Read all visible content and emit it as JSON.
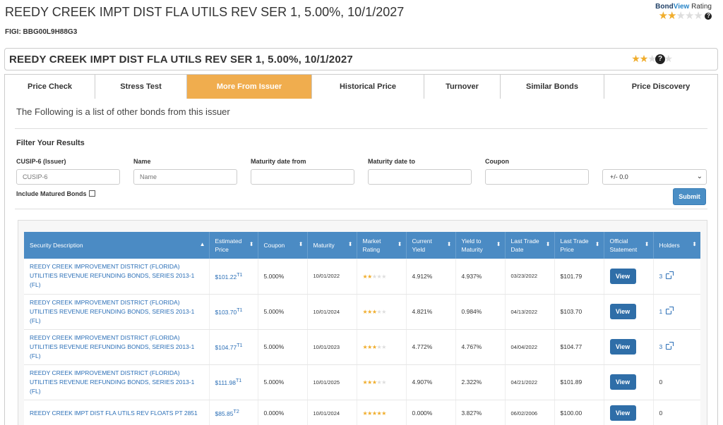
{
  "page": {
    "title": "REEDY CREEK IMPT DIST FLA UTILS REV SER 1, 5.00%, 10/1/2027",
    "figi": "FIGI: BBG00L9H88G3"
  },
  "bondview": {
    "label_bond": "Bond",
    "label_view": "View",
    "label_rating": " Rating",
    "stars_on": "★★",
    "stars_off": "★★★",
    "help": "?"
  },
  "header": {
    "name": "REEDY CREEK IMPT DIST FLA UTILS REV SER 1, 5.00%, 10/1/2027",
    "stars_on": "★★",
    "stars_off": "★★★",
    "help": "?"
  },
  "tabs": [
    {
      "label": "Price Check"
    },
    {
      "label": "Stress Test"
    },
    {
      "label": "More From Issuer"
    },
    {
      "label": "Historical Price"
    },
    {
      "label": "Turnover"
    },
    {
      "label": "Similar Bonds"
    },
    {
      "label": "Price Discovery"
    }
  ],
  "content": {
    "intro": "The Following is a list of other bonds from this issuer",
    "filter_title": "Filter Your Results",
    "filters": {
      "cusip_label": "CUSIP-6 (Issuer)",
      "cusip_placeholder": "CUSIP-6",
      "name_label": "Name",
      "name_placeholder": "Name",
      "mat_from_label": "Maturity date from",
      "mat_to_label": "Maturity date to",
      "coupon_label": "Coupon",
      "coupon_select": "+/- 0.0",
      "matured_label": "Include Matured Bonds",
      "submit": "Submit"
    }
  },
  "table": {
    "headers": [
      {
        "l1": "Security Description",
        "l2": ""
      },
      {
        "l1": "Estimated",
        "l2": "Price"
      },
      {
        "l1": "Coupon",
        "l2": ""
      },
      {
        "l1": "Maturity",
        "l2": ""
      },
      {
        "l1": "Market",
        "l2": "Rating"
      },
      {
        "l1": "Current",
        "l2": "Yield"
      },
      {
        "l1": "Yield to",
        "l2": "Maturity"
      },
      {
        "l1": "Last Trade",
        "l2": "Date"
      },
      {
        "l1": "Last Trade",
        "l2": "Price"
      },
      {
        "l1": "Official",
        "l2": "Statement"
      },
      {
        "l1": "Holders",
        "l2": ""
      }
    ],
    "rows": [
      {
        "desc": "REEDY CREEK IMPROVEMENT DISTRICT (FLORIDA) UTILITIES REVENUE REFUNDING BONDS, SERIES 2013-1 (FL)",
        "price": "$101.22",
        "tag": "T1",
        "coupon": "5.000%",
        "maturity": "10/01/2022",
        "stars_on": "★★",
        "stars_off": "★★★",
        "cy": "4.912%",
        "ytm": "4.937%",
        "ltd": "03/23/2022",
        "ltp": "$101.79",
        "view": "View",
        "holders": "3",
        "link": true
      },
      {
        "desc": "REEDY CREEK IMPROVEMENT DISTRICT (FLORIDA) UTILITIES REVENUE REFUNDING BONDS, SERIES 2013-1 (FL)",
        "price": "$103.70",
        "tag": "T1",
        "coupon": "5.000%",
        "maturity": "10/01/2024",
        "stars_on": "★★★",
        "stars_off": "★★",
        "cy": "4.821%",
        "ytm": "0.984%",
        "ltd": "04/13/2022",
        "ltp": "$103.70",
        "view": "View",
        "holders": "1",
        "link": true
      },
      {
        "desc": "REEDY CREEK IMPROVEMENT DISTRICT (FLORIDA) UTILITIES REVENUE REFUNDING BONDS, SERIES 2013-1 (FL)",
        "price": "$104.77",
        "tag": "T1",
        "coupon": "5.000%",
        "maturity": "10/01/2023",
        "stars_on": "★★★",
        "stars_off": "★★",
        "cy": "4.772%",
        "ytm": "4.767%",
        "ltd": "04/04/2022",
        "ltp": "$104.77",
        "view": "View",
        "holders": "3",
        "link": true
      },
      {
        "desc": "REEDY CREEK IMPROVEMENT DISTRICT (FLORIDA) UTILITIES REVENUE REFUNDING BONDS, SERIES 2013-1 (FL)",
        "price": "$111.98",
        "tag": "T1",
        "coupon": "5.000%",
        "maturity": "10/01/2025",
        "stars_on": "★★★",
        "stars_off": "★★",
        "cy": "4.907%",
        "ytm": "2.322%",
        "ltd": "04/21/2022",
        "ltp": "$101.89",
        "view": "View",
        "holders": "0",
        "link": false
      },
      {
        "desc": "REEDY CREEK IMPT DIST FLA UTILS REV FLOATS PT 2851",
        "price": "$85.85",
        "tag": "T2",
        "coupon": "0.000%",
        "maturity": "10/01/2024",
        "stars_on": "★★★★★",
        "stars_off": "",
        "cy": "0.000%",
        "ytm": "3.827%",
        "ltd": "06/02/2006",
        "ltp": "$100.00",
        "view": "View",
        "holders": "0",
        "link": false
      }
    ]
  },
  "colors": {
    "accent_tab": "#f0ad4e",
    "table_header": "#4b8bc4",
    "view_button": "#2f6ea8",
    "link": "#2a6eb6",
    "star": "#f0ad2c"
  }
}
